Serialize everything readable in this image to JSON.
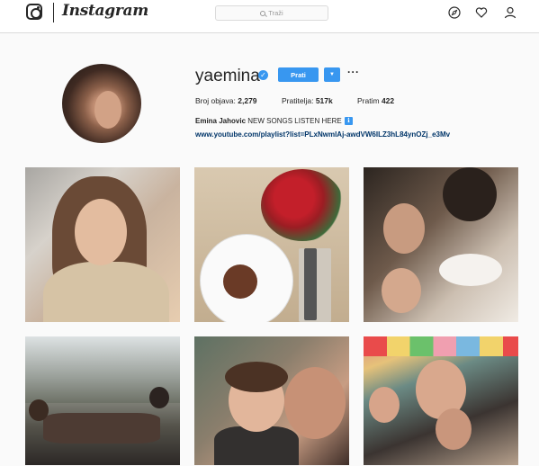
{
  "nav": {
    "wordmark": "Instagram",
    "search_placeholder": "Traži",
    "icons": [
      "instagram-glyph-icon",
      "compass-icon",
      "heart-icon",
      "user-icon"
    ]
  },
  "profile": {
    "username": "yaemina",
    "verified": true,
    "follow_label": "Prati",
    "more_label": "···",
    "stats": {
      "posts_label": "Broj objava:",
      "posts_value": "2,279",
      "followers_label": "Pratitelja:",
      "followers_value": "517k",
      "following_label": "Pratim",
      "following_value": "422"
    },
    "bio_name": "Emina Jahovic",
    "bio_text": "NEW SONGS LISTEN HERE",
    "bio_icon": "ℹ",
    "bio_link": "www.youtube.com/playlist?list=PLxNwmlAj-awdVW6ILZ3hL84ynOZj_e3Mv"
  },
  "colors": {
    "accent": "#3897f0",
    "link": "#003569",
    "background": "#fafafa"
  },
  "posts": [
    {
      "subject": "selfie-in-car"
    },
    {
      "subject": "steak-and-roses"
    },
    {
      "subject": "restaurant-group-selfie"
    },
    {
      "subject": "family-dinner-window"
    },
    {
      "subject": "mother-and-son"
    },
    {
      "subject": "birthday-party"
    }
  ]
}
